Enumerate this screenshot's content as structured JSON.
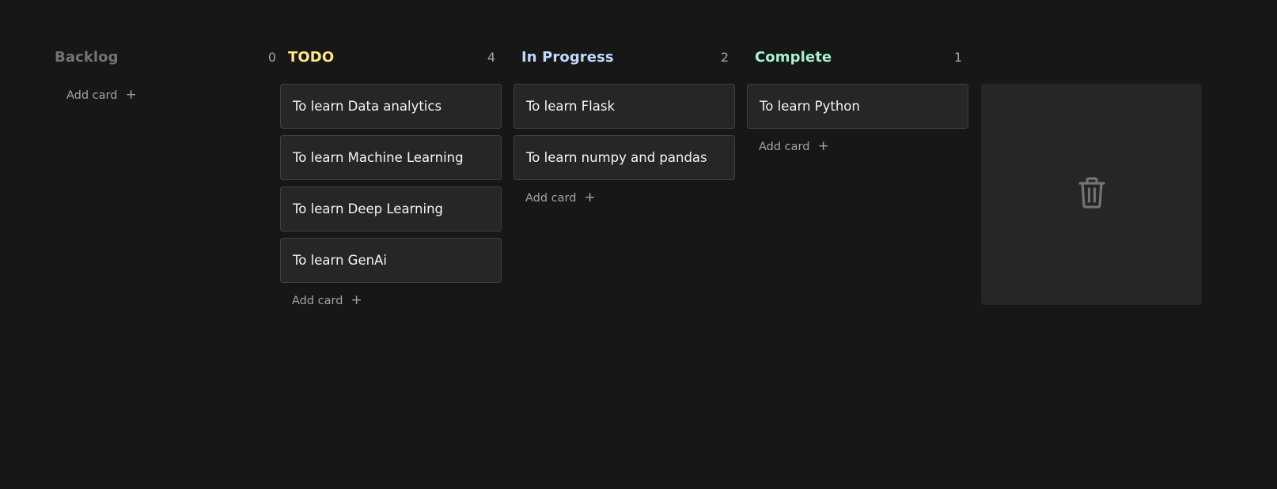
{
  "board": {
    "columns": [
      {
        "title": "Backlog",
        "count": "0",
        "color": "#737373",
        "cards": [],
        "add_label": "Add card"
      },
      {
        "title": "TODO",
        "count": "4",
        "color": "#fde68a",
        "cards": [
          "To learn Data analytics",
          "To learn Machine Learning",
          "To learn Deep Learning",
          "To learn GenAi"
        ],
        "add_label": "Add card"
      },
      {
        "title": "In Progress",
        "count": "2",
        "color": "#bfdbfe",
        "cards": [
          "To learn Flask",
          "To learn numpy and pandas"
        ],
        "add_label": "Add card"
      },
      {
        "title": "Complete",
        "count": "1",
        "color": "#a7f3d0",
        "cards": [
          "To learn Python"
        ],
        "add_label": "Add card"
      }
    ],
    "trash": {
      "icon": "trash-icon"
    }
  }
}
